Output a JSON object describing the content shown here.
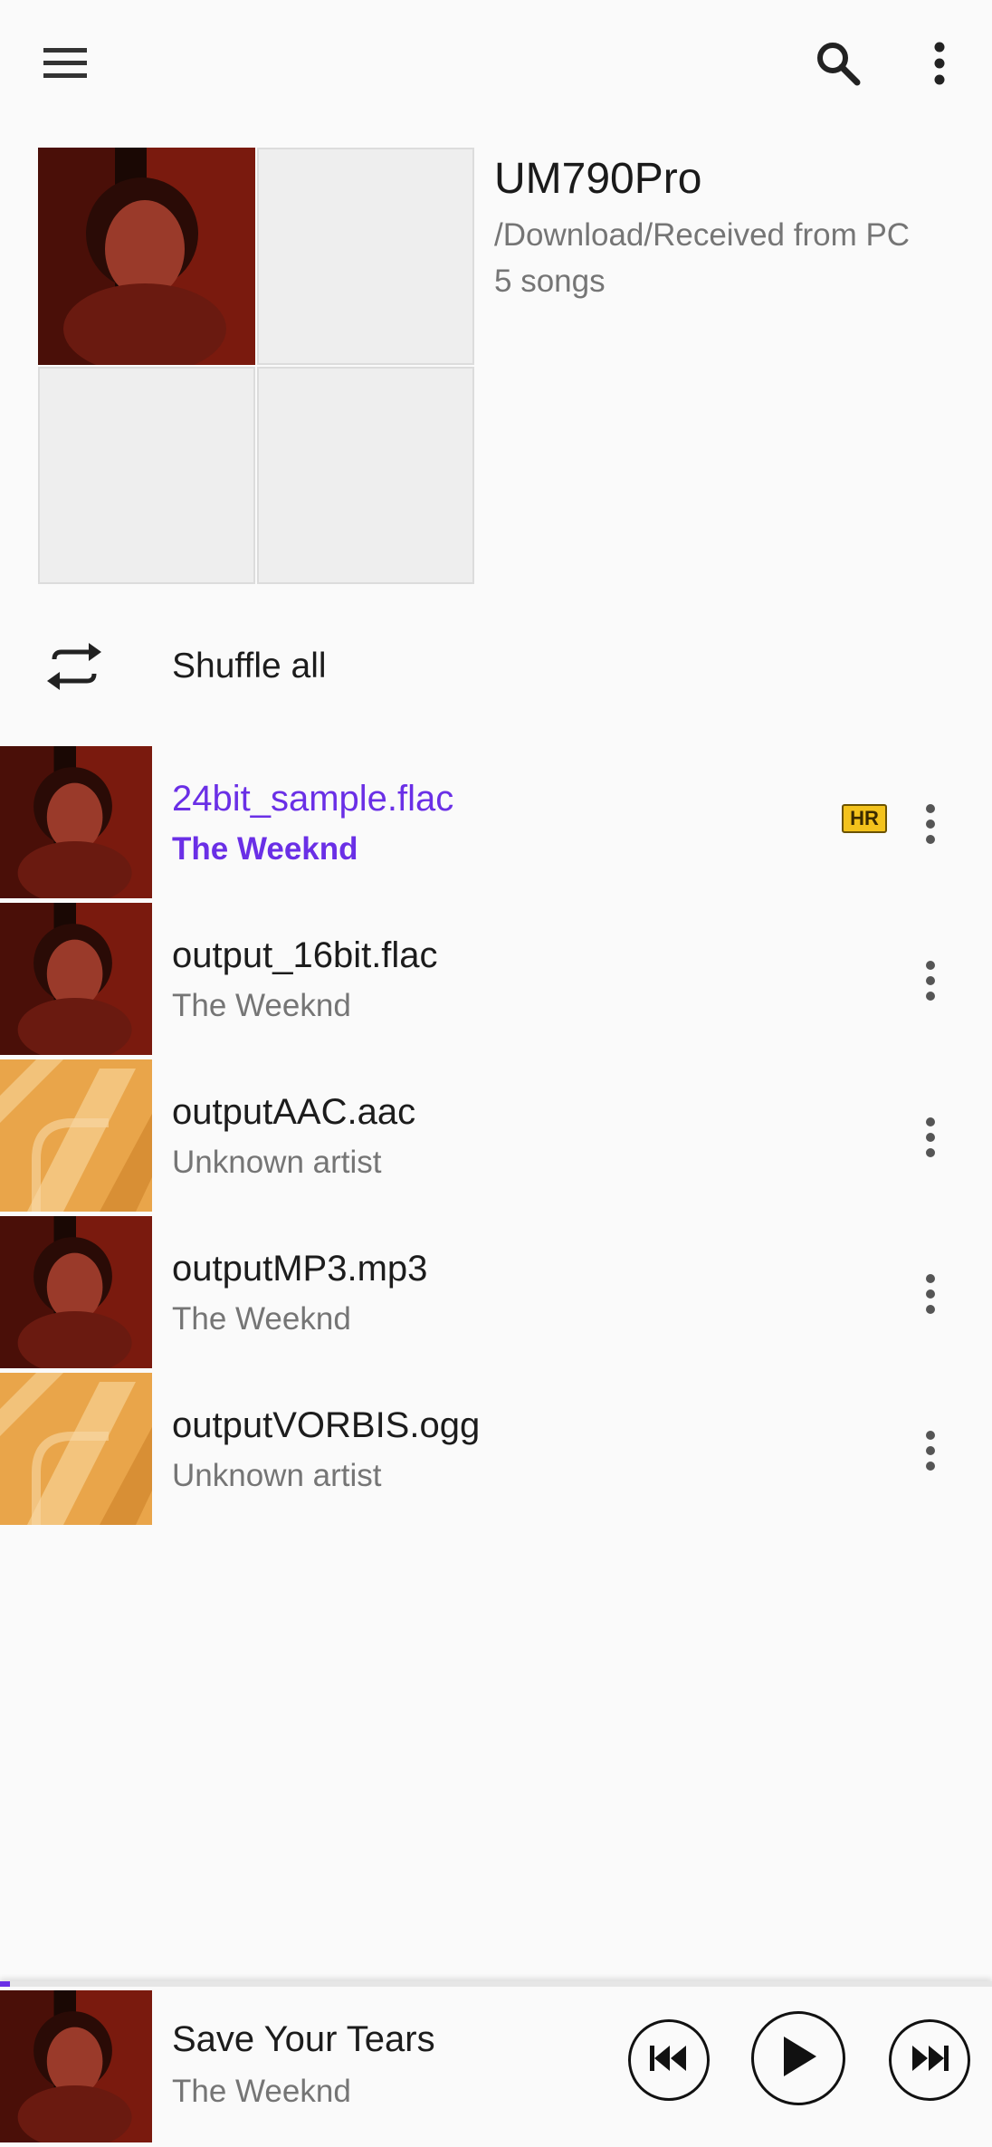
{
  "colors": {
    "accent": "#6a2fe6",
    "text_primary": "#1c1c1c",
    "text_secondary": "#757575",
    "badge": "#f3c21c"
  },
  "toolbar": {
    "menu_icon": "hamburger-menu-icon",
    "search_icon": "search-icon",
    "more_icon": "more-vert-icon"
  },
  "folder": {
    "name": "UM790Pro",
    "path": "/Download/Received from PC",
    "count": "5 songs"
  },
  "shuffle": {
    "label": "Shuffle all",
    "icon": "shuffle-repeat-icon"
  },
  "songs": [
    {
      "title": "24bit_sample.flac",
      "artist": "The Weeknd",
      "art": "weeknd",
      "badge": "HR",
      "active": true
    },
    {
      "title": "output_16bit.flac",
      "artist": "The Weeknd",
      "art": "weeknd",
      "badge": "",
      "active": false
    },
    {
      "title": "outputAAC.aac",
      "artist": "Unknown artist",
      "art": "placeholder",
      "badge": "",
      "active": false
    },
    {
      "title": "outputMP3.mp3",
      "artist": "The Weeknd",
      "art": "weeknd",
      "badge": "",
      "active": false
    },
    {
      "title": "outputVORBIS.ogg",
      "artist": "Unknown artist",
      "art": "placeholder",
      "badge": "",
      "active": false
    }
  ],
  "now_playing": {
    "title": "Save Your Tears",
    "artist": "The Weeknd",
    "progress": 0.01,
    "prev_icon": "skip-previous-icon",
    "play_icon": "play-icon",
    "next_icon": "skip-next-icon"
  }
}
